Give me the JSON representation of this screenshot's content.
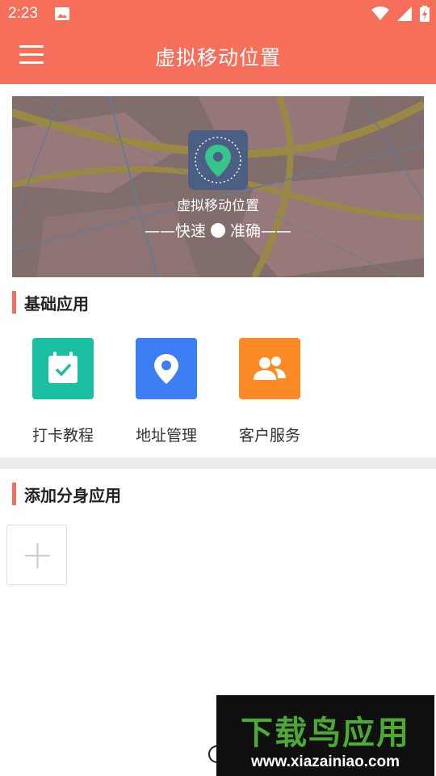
{
  "status_bar": {
    "time": "2:23"
  },
  "app_bar": {
    "title": "虚拟移动位置"
  },
  "banner": {
    "title": "虚拟移动位置",
    "subtitle_left": "——快速",
    "subtitle_right": "准确——"
  },
  "sections": {
    "basic": {
      "title": "基础应用",
      "items": [
        {
          "label": "打卡教程",
          "icon": "calendar-check-icon",
          "color": "#19bfa0"
        },
        {
          "label": "地址管理",
          "icon": "location-pin-icon",
          "color": "#3d7ef5"
        },
        {
          "label": "客户服务",
          "icon": "users-icon",
          "color": "#fb8a24"
        }
      ]
    },
    "clone": {
      "title": "添加分身应用"
    }
  },
  "watermark": {
    "title": "下载鸟应用",
    "url": "www.xiazainiao.com"
  },
  "colors": {
    "accent": "#f56f5a",
    "divider": "#ececec"
  }
}
